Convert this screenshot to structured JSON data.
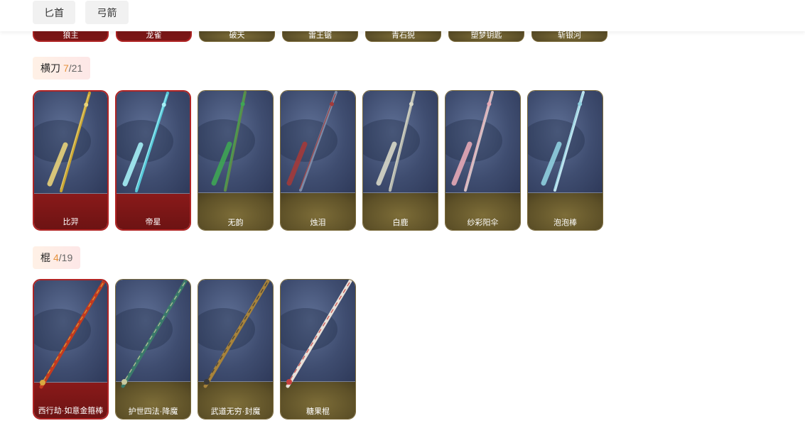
{
  "tabs": [
    {
      "label": "匕首"
    },
    {
      "label": "弓箭"
    }
  ],
  "prev_row": [
    {
      "name": "狼主",
      "rarity": "red"
    },
    {
      "name": "龙雀",
      "rarity": "red"
    },
    {
      "name": "破天",
      "rarity": "gold"
    },
    {
      "name": "雷王锯",
      "rarity": "gold"
    },
    {
      "name": "青石猊",
      "rarity": "gold"
    },
    {
      "name": "塑梦钥匙",
      "rarity": "gold"
    },
    {
      "name": "斩银河",
      "rarity": "gold"
    }
  ],
  "sections": [
    {
      "title": "横刀",
      "owned": "7",
      "total": "/21",
      "items": [
        {
          "name": "比羿",
          "rarity": "red",
          "blade": "#c9a633",
          "accent": "#e8d27a",
          "icon": "golden-sword-icon"
        },
        {
          "name": "帝星",
          "rarity": "red",
          "blade": "#56c8d8",
          "accent": "#a6f0f7",
          "icon": "crystal-sword-icon"
        },
        {
          "name": "无韵",
          "rarity": "gold",
          "blade": "#5d8a4a",
          "accent": "#3fa655",
          "icon": "jade-sword-icon"
        },
        {
          "name": "烛泪",
          "rarity": "gold",
          "blade": "#7c8aa6",
          "accent": "#a33a3a",
          "icon": "dark-sword-icon"
        },
        {
          "name": "白鹿",
          "rarity": "gold",
          "blade": "#b6b9b0",
          "accent": "#d8d8c8",
          "icon": "silver-sword-icon"
        },
        {
          "name": "纱彩阳伞",
          "rarity": "gold",
          "blade": "#d4c0c4",
          "accent": "#e6a9b6",
          "icon": "parasol-sword-icon"
        },
        {
          "name": "泡泡棒",
          "rarity": "gold",
          "blade": "#bfe4ef",
          "accent": "#8fd0df",
          "icon": "bubble-wand-icon"
        }
      ]
    },
    {
      "title": "棍",
      "owned": "4",
      "total": "/19",
      "items": [
        {
          "name": "西行劫·如意金箍棒",
          "rarity": "red",
          "blade": "#c43a1e",
          "accent": "#d8aa40",
          "icon": "golden-staff-icon"
        },
        {
          "name": "护世四法·降魔",
          "rarity": "gold",
          "blade": "#3a7a6a",
          "accent": "#c9c9a0",
          "icon": "jade-staff-icon"
        },
        {
          "name": "武道无穷·封魔",
          "rarity": "gold",
          "blade": "#a8833a",
          "accent": "#3a3a3a",
          "icon": "bronze-staff-icon"
        },
        {
          "name": "糖果棍",
          "rarity": "gold",
          "blade": "#e8e0d8",
          "accent": "#c94040",
          "icon": "candy-cane-staff-icon"
        }
      ]
    }
  ]
}
